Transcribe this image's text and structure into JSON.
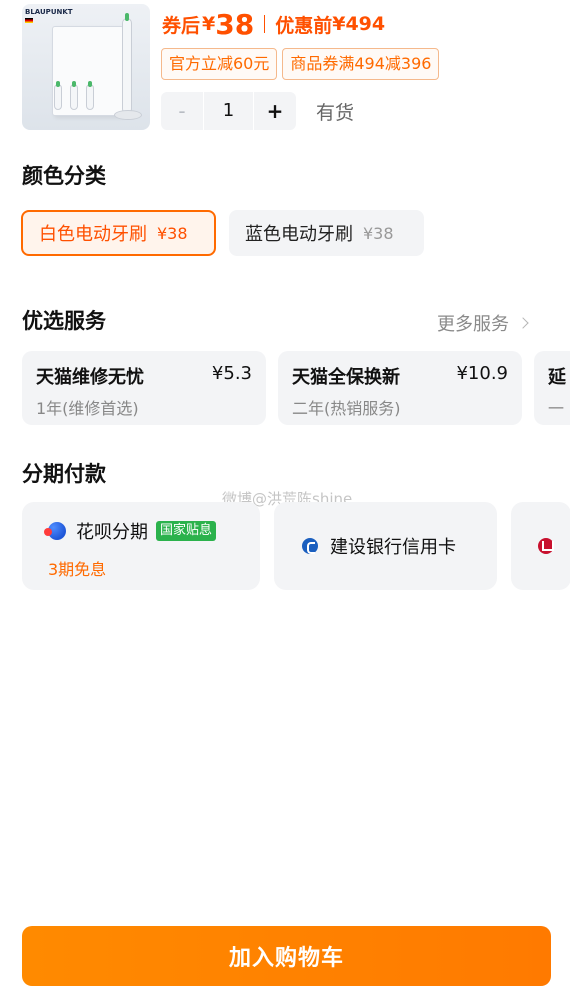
{
  "product": {
    "image_brand": "BLAUPUNKT",
    "price_after_coupon_label": "券后",
    "price_after_coupon_currency": "¥",
    "price_after_coupon_value": "38",
    "price_before_label": "优惠前",
    "price_before_value": "¥494",
    "coupons": [
      "官方立减60元",
      "商品券满494减396"
    ],
    "quantity": "1",
    "minus_label": "-",
    "plus_label": "+",
    "stock_status": "有货"
  },
  "color_section": {
    "title": "颜色分类",
    "options": [
      {
        "label": "白色电动牙刷",
        "price": "¥38",
        "selected": true
      },
      {
        "label": "蓝色电动牙刷",
        "price": "¥38",
        "selected": false
      }
    ]
  },
  "service_section": {
    "title": "优选服务",
    "more_label": "更多服务",
    "items": [
      {
        "name": "天猫维修无忧",
        "price": "¥5.3",
        "desc": "1年(维修首选)"
      },
      {
        "name": "天猫全保换新",
        "price": "¥10.9",
        "desc": "二年(热销服务)"
      },
      {
        "name": "延",
        "price": "",
        "desc": "一"
      }
    ]
  },
  "installment_section": {
    "title": "分期付款",
    "items": [
      {
        "name": "花呗分期",
        "tag": "国家贴息",
        "sub": "3期免息"
      },
      {
        "name": "建设银行信用卡"
      }
    ]
  },
  "watermark": "微博@洪荒陈shine",
  "add_to_cart_label": "加入购物车",
  "colors": {
    "accent": "#ff6a00",
    "price": "#ff5000",
    "card_bg": "#f3f4f6"
  }
}
